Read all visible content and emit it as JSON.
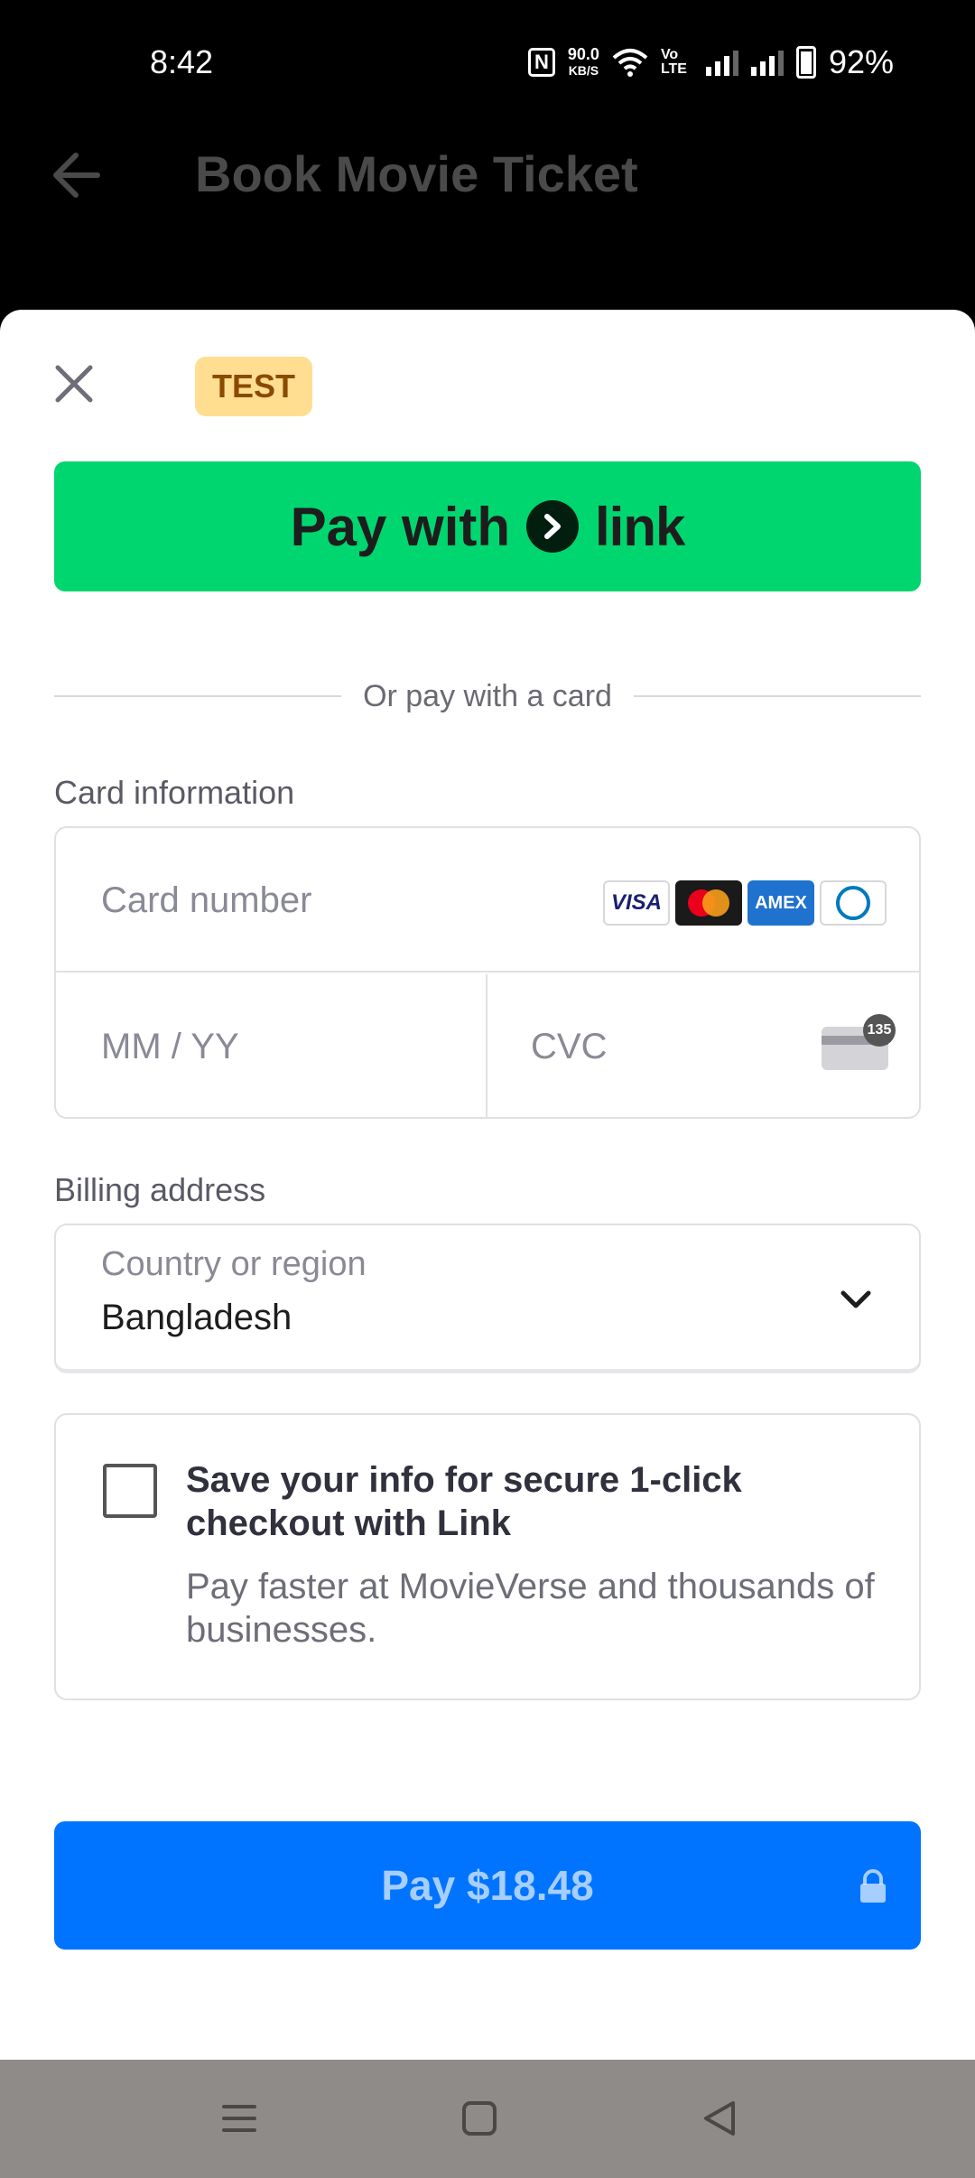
{
  "status_bar": {
    "time": "8:42",
    "network_speed_value": "90.0",
    "network_speed_unit": "KB/S",
    "volte": "Vo LTE",
    "battery_percent": "92%"
  },
  "header": {
    "title": "Book Movie Ticket"
  },
  "sheet": {
    "badge": "TEST",
    "link_button": {
      "prefix": "Pay with",
      "brand": "link",
      "color": "#00d66f"
    },
    "divider_text": "Or pay with a card",
    "card_section": {
      "label": "Card information",
      "card_number_placeholder": "Card number",
      "expiry_placeholder": "MM / YY",
      "cvc_placeholder": "CVC",
      "cvc_badge": "135",
      "brands": [
        "VISA",
        "mastercard",
        "AMEX",
        "diners"
      ]
    },
    "billing_section": {
      "label": "Billing address",
      "country_label": "Country or region",
      "country_value": "Bangladesh"
    },
    "save_info": {
      "checked": false,
      "title": "Save your info for secure 1-click checkout with Link",
      "subtitle": "Pay faster at MovieVerse and thousands of businesses."
    },
    "pay_button": {
      "label": "Pay $18.48",
      "color": "#0074ff"
    }
  },
  "nav_bar": {
    "icons": [
      "menu-icon",
      "home-square-icon",
      "back-triangle-icon"
    ]
  }
}
